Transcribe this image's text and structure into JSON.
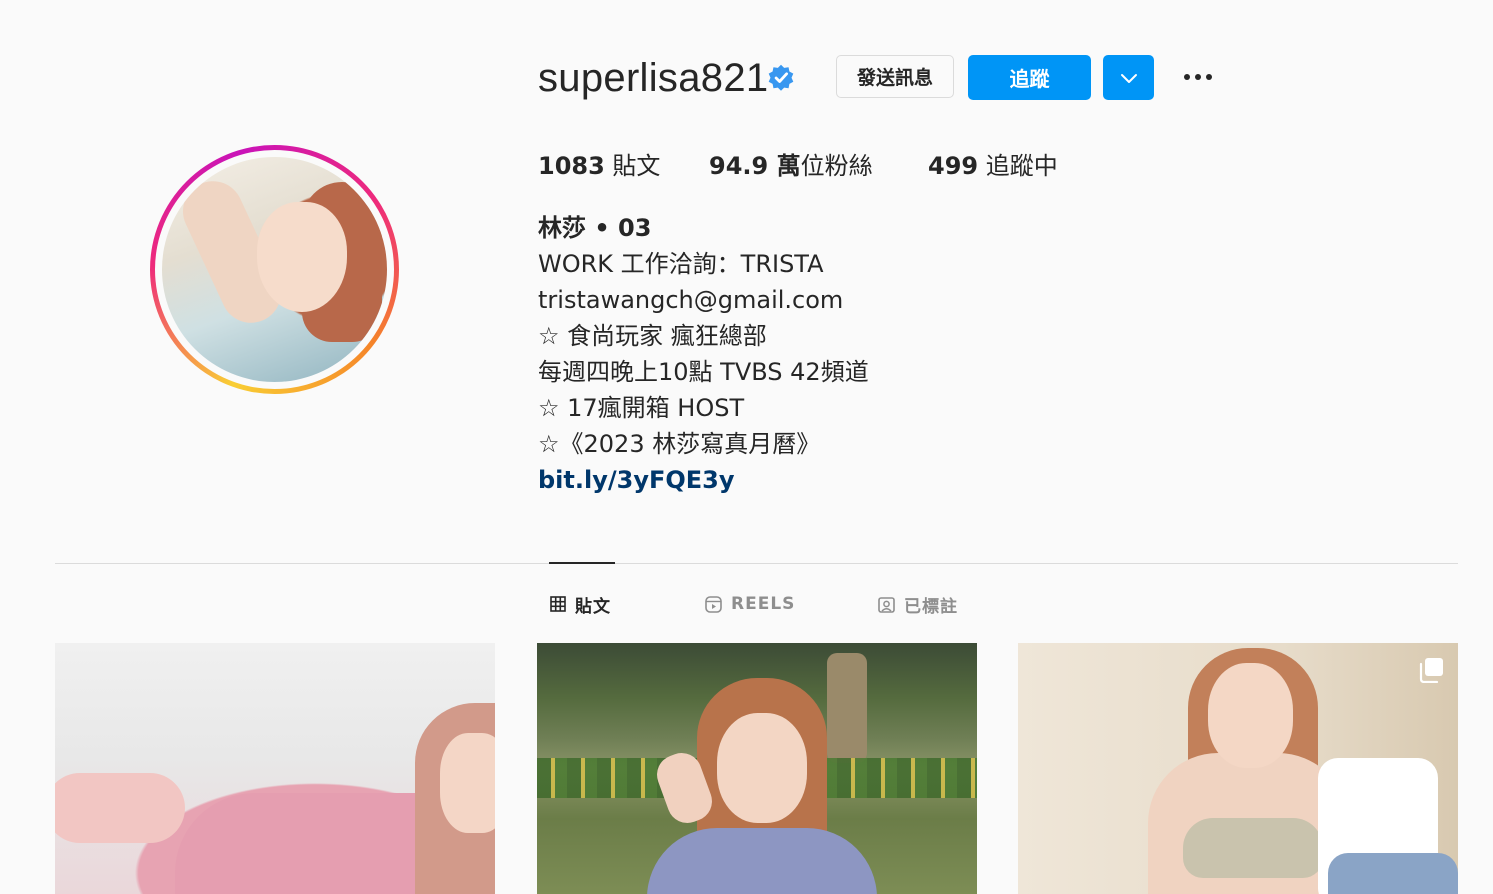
{
  "profile": {
    "username": "superlisa821",
    "verified_icon": "verified-badge-icon",
    "message_button": "發送訊息",
    "follow_button": "追蹤",
    "stats": {
      "posts_count": "1083",
      "posts_label": " 貼文",
      "followers_count": "94.9 萬",
      "followers_label": "位粉絲",
      "following_count": "499",
      "following_label": " 追蹤中"
    },
    "bio": {
      "name": "林莎 • 03",
      "lines": [
        "WORK 工作洽詢：TRISTA",
        "tristawangch@gmail.com",
        "☆ 食尚玩家 瘋狂總部",
        "每週四晚上10點 TVBS 42頻道",
        "☆ 17瘋開箱 HOST",
        "☆《2023 林莎寫真月曆》"
      ],
      "link": "bit.ly/3yFQE3y"
    }
  },
  "tabs": [
    {
      "label": "貼文",
      "icon": "grid-icon",
      "active": true
    },
    {
      "label": "REELS",
      "icon": "reels-icon",
      "active": false
    },
    {
      "label": "已標註",
      "icon": "tagged-icon",
      "active": false
    }
  ],
  "colors": {
    "accent": "#0095f6",
    "link": "#00376b",
    "background": "#fafafa"
  }
}
